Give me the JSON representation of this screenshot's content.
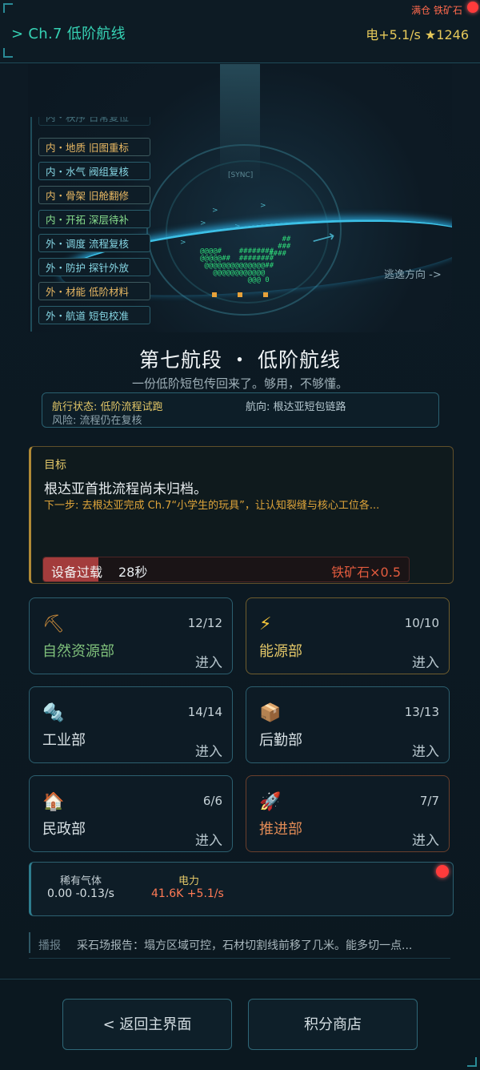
{
  "header": {
    "chapter": "> Ch.7 低阶航线",
    "stats": "电+5.1/s ★1246",
    "storage_alert": "满仓 铁矿石"
  },
  "scene": {
    "sync_label": "[SYNC]",
    "escape_label": "逃逸方向 ->",
    "side_tags": [
      {
        "text": "内・秩序 日常复位"
      },
      {
        "text": "内・地质 旧图重标"
      },
      {
        "text": "内・水气 阀组复核"
      },
      {
        "text": "内・骨架 旧舱翻修"
      },
      {
        "text": "内・开拓 深层待补"
      },
      {
        "text": "外・调度 流程复核"
      },
      {
        "text": "外・防护 探针外放"
      },
      {
        "text": "外・材能 低阶材料"
      },
      {
        "text": "外・航道 短包校准"
      }
    ]
  },
  "title": "第七航段 ・ 低阶航线",
  "subtitle": "一份低阶短包传回来了。够用，不够懂。",
  "status": {
    "state": "航行状态: 低阶流程试跑",
    "heading": "航向: 根达亚短包链路",
    "risk": "风险: 流程仍在复核"
  },
  "objective": {
    "label": "目标",
    "main": "根达亚首批流程尚未归档。",
    "next": "下一步: 去根达亚完成 Ch.7“小学生的玩具”，让认知裂缝与核心工位各...",
    "overload_label": "设备过载",
    "overload_time": "28秒",
    "overload_fraction": 0.15,
    "overload_effect": "铁矿石×0.5"
  },
  "departments": [
    {
      "name": "自然资源部",
      "count": "12/12",
      "enter": "进入",
      "icon": "⛏",
      "color": "#7fc07b"
    },
    {
      "name": "能源部",
      "count": "10/10",
      "enter": "进入",
      "icon": "⚡",
      "color": "#e3c768"
    },
    {
      "name": "工业部",
      "count": "14/14",
      "enter": "进入",
      "icon": "🔩",
      "color": "#d7e0e4"
    },
    {
      "name": "后勤部",
      "count": "13/13",
      "enter": "进入",
      "icon": "📦",
      "color": "#d7e0e4"
    },
    {
      "name": "民政部",
      "count": "6/6",
      "enter": "进入",
      "icon": "🏠",
      "color": "#d7e0e4"
    },
    {
      "name": "推进部",
      "count": "7/7",
      "enter": "进入",
      "icon": "🚀",
      "color": "#e08a55"
    }
  ],
  "resources": {
    "rare_gas_label": "稀有气体",
    "rare_gas_value": "0.00 -0.13/s",
    "power_label": "电力",
    "power_value": "41.6K +5.1/s"
  },
  "broadcast": {
    "label": "播报",
    "message": "采石场报告：塌方区域可控，石材切割线前移了几米。能多切一点..."
  },
  "buttons": {
    "back": "< 返回主界面",
    "shop": "积分商店"
  },
  "colors": {
    "accent": "#36d3b5",
    "gold": "#e3c768",
    "alert": "#ff3b3b"
  }
}
